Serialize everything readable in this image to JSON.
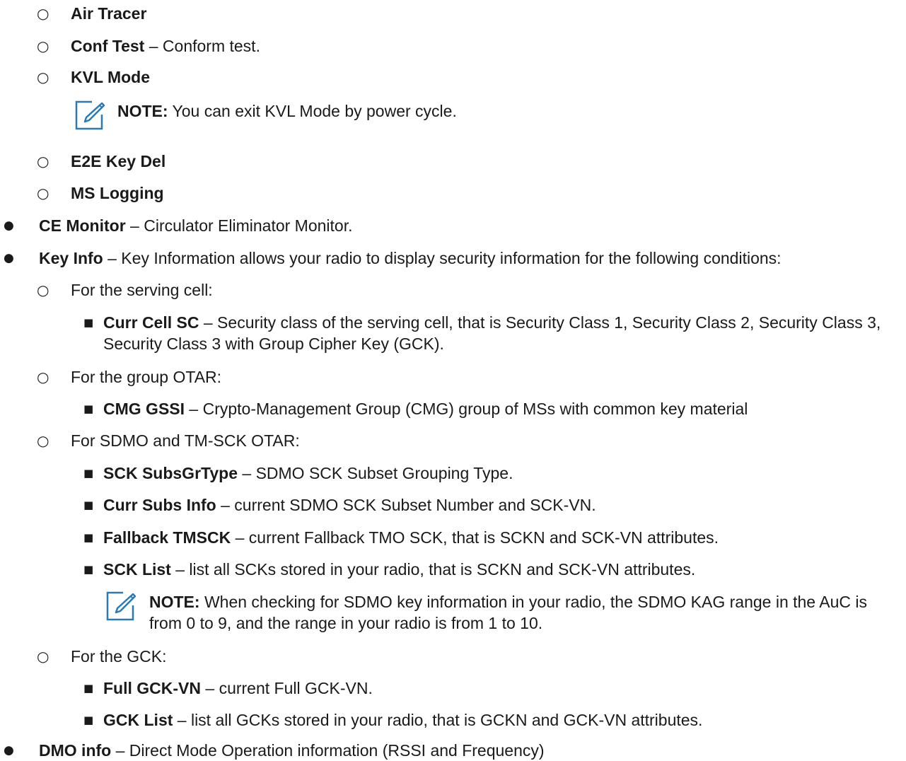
{
  "items": {
    "air_tracer": {
      "term": "Air Tracer"
    },
    "conf_test": {
      "term": "Conf Test",
      "desc": " – Conform test."
    },
    "kvl_mode": {
      "term": "KVL Mode"
    },
    "note1": {
      "label": "NOTE:",
      "text": " You can exit KVL Mode by power cycle."
    },
    "e2e": {
      "term": "E2E Key Del"
    },
    "ms_logging": {
      "term": "MS Logging"
    },
    "ce_monitor": {
      "term": "CE Monitor",
      "desc": " – Circulator Eliminator Monitor."
    },
    "key_info": {
      "term": "Key Info",
      "desc": " – Key Information allows your radio to display security information for the following conditions:"
    },
    "serving_cell": {
      "text": "For the serving cell:"
    },
    "curr_cell_sc": {
      "term": "Curr Cell SC",
      "desc": " – Security class of the serving cell, that is Security Class 1, Security Class 2, Security Class 3, Security Class 3 with Group Cipher Key (GCK)."
    },
    "group_otar": {
      "text": "For the group OTAR:"
    },
    "cmg_gssi": {
      "term": "CMG GSSI",
      "desc": " – Crypto-Management Group (CMG) group of MSs with common key material"
    },
    "sdmo_otar": {
      "text": "For SDMO and TM-SCK OTAR:"
    },
    "sck_subsgrtype": {
      "term": "SCK SubsGrType",
      "desc": " – SDMO SCK Subset Grouping Type."
    },
    "curr_subs_info": {
      "term": "Curr Subs Info",
      "desc": " – current SDMO SCK Subset Number and SCK-VN."
    },
    "fallback_tmsck": {
      "term": "Fallback TMSCK",
      "desc": " – current Fallback TMO SCK, that is SCKN and SCK-VN attributes."
    },
    "sck_list": {
      "term": "SCK List",
      "desc": " – list all SCKs stored in your radio, that is SCKN and SCK-VN attributes."
    },
    "note2": {
      "label": "NOTE:",
      "text": " When checking for SDMO key information in your radio, the SDMO KAG range in the AuC is from 0 to 9, and the range in your radio is from 1 to 10."
    },
    "for_gck": {
      "text": "For the GCK:"
    },
    "full_gck_vn": {
      "term": "Full GCK-VN",
      "desc": " – current Full GCK-VN."
    },
    "gck_list": {
      "term": "GCK List",
      "desc": " – list all GCKs stored in your radio, that is GCKN and GCK-VN attributes."
    },
    "dmo_info": {
      "term": "DMO info",
      "desc": " – Direct Mode Operation information (RSSI and Frequency)"
    }
  },
  "markers": {
    "level1": "●",
    "level2": "○",
    "level3": "■"
  },
  "icons": {
    "note": "pencil-note-icon"
  },
  "colors": {
    "text": "#1a1a1a",
    "icon": "#2a79b8"
  }
}
